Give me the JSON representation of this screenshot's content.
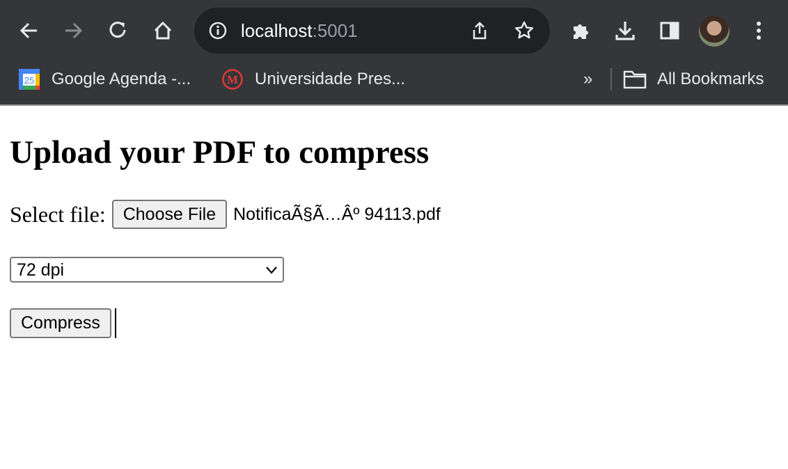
{
  "browser": {
    "url_host": "localhost",
    "url_port": ":5001",
    "bookmarks": [
      {
        "label": "Google Agenda -...",
        "icon": "google-calendar-icon",
        "badge": "25"
      },
      {
        "label": "Universidade Pres...",
        "icon": "mackenzie-icon",
        "badge": "M"
      }
    ],
    "overflow_label": "»",
    "all_bookmarks_label": "All Bookmarks"
  },
  "page": {
    "title": "Upload your PDF to compress",
    "file_label": "Select file:",
    "choose_file_label": "Choose File",
    "file_name": "NotificaÃ§Ã…Âº 94113.pdf",
    "dpi_selected": "72 dpi",
    "compress_label": "Compress"
  },
  "colors": {
    "chrome_bg": "#35363a",
    "omnibox_bg": "#202124",
    "calendar_blue": "#4285f4",
    "mackenzie_red": "#e53935"
  }
}
